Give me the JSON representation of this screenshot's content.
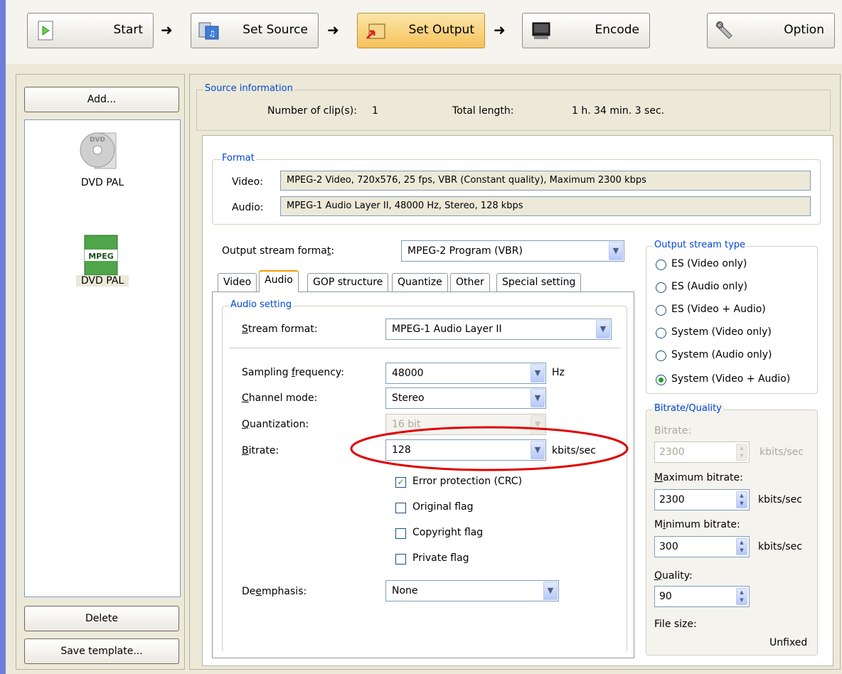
{
  "toolbar": {
    "steps": [
      {
        "label": "Start"
      },
      {
        "label": "Set Source"
      },
      {
        "label": "Set Output"
      },
      {
        "label": "Encode"
      }
    ],
    "option_label": "Option"
  },
  "left": {
    "add_label": "Add...",
    "clips": [
      "DVD PAL",
      "DVD PAL"
    ],
    "delete_label": "Delete",
    "save_template_label": "Save template..."
  },
  "source_info": {
    "legend": "Source information",
    "clips_label": "Number of clip(s):",
    "clips_value": "1",
    "length_label": "Total length:",
    "length_value": "1 h. 34 min. 3 sec."
  },
  "format": {
    "legend": "Format",
    "video_label": "Video:",
    "video_value": "MPEG-2 Video, 720x576, 25 fps, VBR (Constant quality), Maximum 2300 kbps",
    "audio_label": "Audio:",
    "audio_value": "MPEG-1 Audio Layer II, 48000 Hz, Stereo, 128 kbps"
  },
  "output_stream": {
    "label_pre": "Output stream forma",
    "label_acc": "t",
    "label_post": ":",
    "value": "MPEG-2 Program (VBR)"
  },
  "tabs": [
    "Video",
    "Audio",
    "GOP structure",
    "Quantize",
    "Other",
    "Special setting"
  ],
  "audio_setting": {
    "legend": "Audio setting",
    "stream_format": {
      "acc": "S",
      "rest": "tream format:",
      "value": "MPEG-1 Audio Layer II"
    },
    "sampling": {
      "pre": "Sampling ",
      "acc": "f",
      "rest": "requency:",
      "value": "48000",
      "unit": "Hz"
    },
    "channel": {
      "acc": "C",
      "rest": "hannel mode:",
      "value": "Stereo"
    },
    "quantization": {
      "acc": "Q",
      "rest": "uantization:",
      "value": "16 bit"
    },
    "bitrate": {
      "acc": "B",
      "rest": "itrate:",
      "value": "128",
      "unit": "kbits/sec"
    },
    "checks": [
      {
        "label": "Error protection (CRC)",
        "checked": true
      },
      {
        "label": "Original flag",
        "checked": false
      },
      {
        "label": "Copyright flag",
        "checked": false
      },
      {
        "label": "Private flag",
        "checked": false
      }
    ],
    "deemphasis": {
      "pre": "De",
      "acc": "e",
      "rest": "mphasis:",
      "value": "None"
    }
  },
  "stream_type": {
    "legend": "Output stream type",
    "options": [
      "ES (Video only)",
      "ES (Audio only)",
      "ES (Video + Audio)",
      "System (Video only)",
      "System (Audio only)",
      "System (Video + Audio)"
    ],
    "selected": "System (Video + Audio)"
  },
  "bitrate_quality": {
    "legend": "Bitrate/Quality",
    "bitrate_label": "Bitrate:",
    "bitrate_value": "2300",
    "bitrate_unit": "kbits/sec",
    "max_label_acc": "M",
    "max_label_rest": "aximum bitrate:",
    "max_value": "2300",
    "max_unit": "kbits/sec",
    "min_label_pre": "M",
    "min_label_acc": "i",
    "min_label_rest": "nimum bitrate:",
    "min_value": "300",
    "min_unit": "kbits/sec",
    "quality_acc": "Q",
    "quality_rest": "uality:",
    "quality_value": "90",
    "filesize_label": "File size:",
    "filesize_value": "Unfixed"
  },
  "highlight_color": "#e00000"
}
